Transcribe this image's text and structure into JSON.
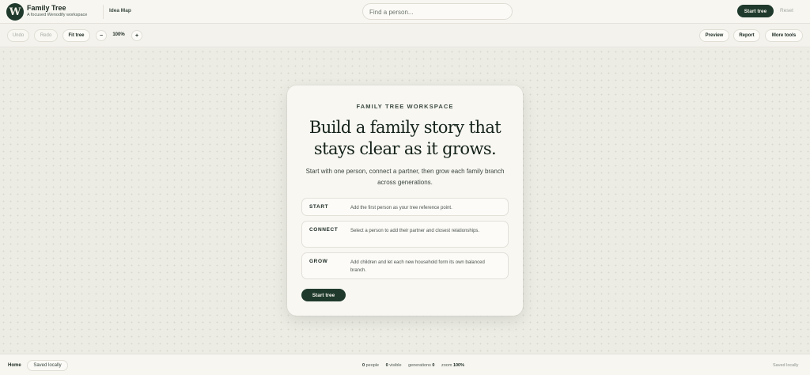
{
  "header": {
    "logo_letter": "W",
    "title": "Family Tree",
    "subtitle": "A focused Wenodify workspace",
    "nav_label": "Idea Map",
    "search_placeholder": "Find a person...",
    "start_tree": "Start tree",
    "reset": "Reset"
  },
  "toolbar": {
    "undo": "Undo",
    "redo": "Redo",
    "fit_tree": "Fit tree",
    "zoom_out": "−",
    "zoom_value": "100%",
    "zoom_in": "+",
    "preview": "Preview",
    "report": "Report",
    "more_tools": "More tools"
  },
  "card": {
    "eyebrow": "FAMILY TREE WORKSPACE",
    "headline_line1": "Build a family story that",
    "headline_line2": "stays clear as it grows.",
    "lead": "Start with one person, connect a partner, then grow each family branch across generations.",
    "steps": [
      {
        "key": "START",
        "text": "Add the first person as your tree reference point."
      },
      {
        "key": "CONNECT",
        "text": "Select a person to add their partner and closest relationships."
      },
      {
        "key": "GROW",
        "text": "Add children and let each new household form its own balanced branch."
      }
    ],
    "cta": "Start tree"
  },
  "footer": {
    "home": "Home",
    "saved_pill": "Saved locally",
    "people_count": "0",
    "people_label": "people",
    "visible_count": "0",
    "visible_label": "visible",
    "generations_label": "generations",
    "generations_count": "0",
    "zoom_label": "zoom",
    "zoom_value": "100%",
    "saved_right": "Saved locally"
  },
  "colors": {
    "accent": "#1f3a2c",
    "background": "#f3f2ec",
    "canvas": "#ecece4"
  }
}
